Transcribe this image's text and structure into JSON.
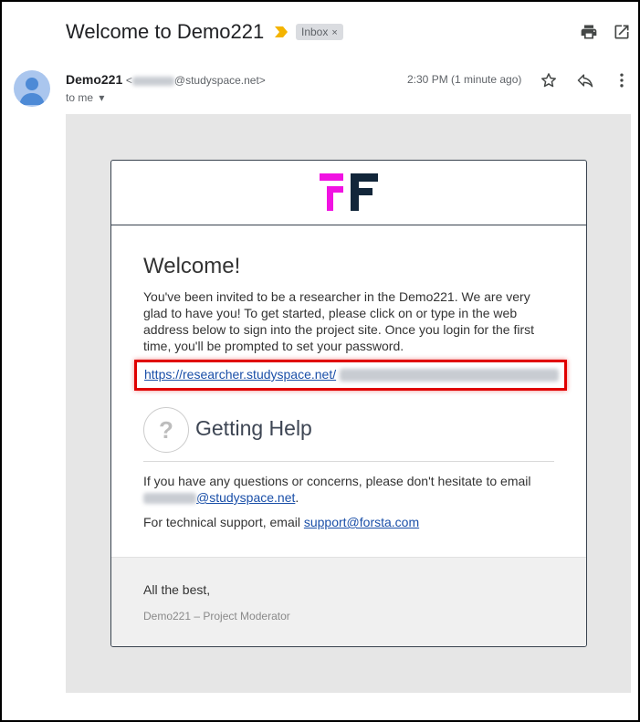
{
  "email": {
    "subject": "Welcome to Demo221",
    "label_chip": "Inbox",
    "chip_remove": "×",
    "sender_name": "Demo221",
    "sender_email_prefix": "<",
    "sender_email_domain": "@studyspace.net>",
    "recipient": "to me",
    "recipient_caret": "▾",
    "time": "2:30 PM (1 minute ago)"
  },
  "body": {
    "welcome": "Welcome!",
    "intro": "You've been invited to be a researcher in the Demo221. We are very glad to have you! To get started, please click on or type in the web address below to sign into the project site. Once you login for the first time, you'll be prompted to set your password.",
    "signup_link": "https://researcher.studyspace.net/",
    "help_mark": "?",
    "help_title": "Getting Help",
    "questions_text": "If you have any questions or concerns, please don't hesitate to email ",
    "contact_domain": "@studyspace.net",
    "questions_end": ".",
    "support_prefix": "For technical support, email ",
    "support_email": "support@forsta.com"
  },
  "footer": {
    "signoff": "All the best,",
    "moderator": "Demo221 – Project Moderator"
  },
  "icons": {
    "importance": "importance-marker-icon",
    "print": "print-icon",
    "new_window": "open-in-new-window-icon",
    "star": "star-icon",
    "reply": "reply-icon",
    "more": "more-vertical-icon",
    "avatar": "avatar-icon",
    "logo": "forsta-logo"
  },
  "colors": {
    "logo_magenta": "#f112e2",
    "logo_navy": "#12263a",
    "link": "#1a4fa8",
    "highlight_border": "#e00000",
    "importance_yellow": "#f4b400"
  }
}
